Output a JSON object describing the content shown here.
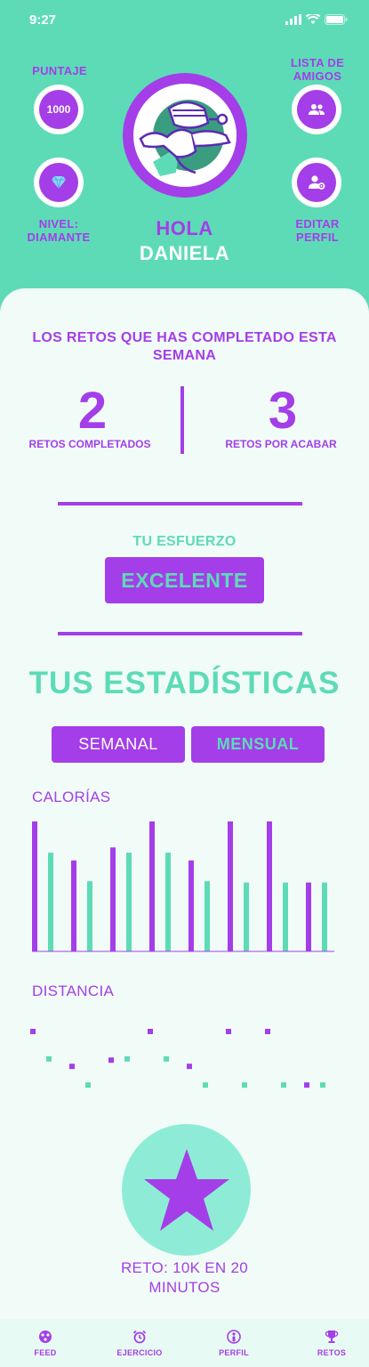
{
  "status": {
    "time": "9:27"
  },
  "header": {
    "puntaje_label": "PUNTAJE",
    "puntaje_value": "1000",
    "amigos_label": "LISTA DE AMIGOS",
    "nivel_label": "NIVEL: DIAMANTE",
    "editar_label": "EDITAR PERFIL",
    "greeting": "HOLA",
    "user_name": "DANIELA"
  },
  "challenges": {
    "title": "LOS RETOS QUE HAS COMPLETADO ESTA SEMANA",
    "completed_value": "2",
    "completed_label": "RETOS COMPLETADOS",
    "pending_value": "3",
    "pending_label": "RETOS POR ACABAR"
  },
  "effort": {
    "label": "TU ESFUERZO",
    "value": "EXCELENTE"
  },
  "stats": {
    "title": "TUS ESTADÍSTICAS",
    "tab_weekly": "SEMANAL",
    "tab_monthly": "MENSUAL",
    "selected_tab": "MENSUAL"
  },
  "chart_data": [
    {
      "type": "bar",
      "title": "CALORÍAS",
      "ylim": [
        0,
        100
      ],
      "grid": false,
      "series": [
        {
          "color": "#a43ee8",
          "values": [
            100,
            70,
            80,
            100,
            70,
            100,
            100,
            53
          ]
        },
        {
          "color": "#5ddbb7",
          "values": [
            76,
            54,
            76,
            76,
            54,
            53,
            53,
            53
          ]
        }
      ]
    },
    {
      "type": "scatter",
      "title": "DISTANCIA",
      "ylim": [
        0,
        100
      ],
      "grid": false,
      "series": [
        {
          "color": "#a43ee8",
          "values": [
            100,
            44,
            54,
            100,
            44,
            100,
            100,
            14
          ]
        },
        {
          "color": "#5ddbb7",
          "values": [
            56,
            14,
            56,
            56,
            14,
            14,
            14,
            14
          ]
        }
      ]
    }
  ],
  "reto": {
    "label": "RETO: 10K EN 20 MINUTOS"
  },
  "nav": {
    "feed": "FEED",
    "ejercicio": "EJERCICIO",
    "perfil": "PERFIL",
    "retos": "RETOS"
  },
  "colors": {
    "accent": "#a43ee8",
    "mint": "#5ddbb7",
    "background": "#f1fcf8"
  }
}
